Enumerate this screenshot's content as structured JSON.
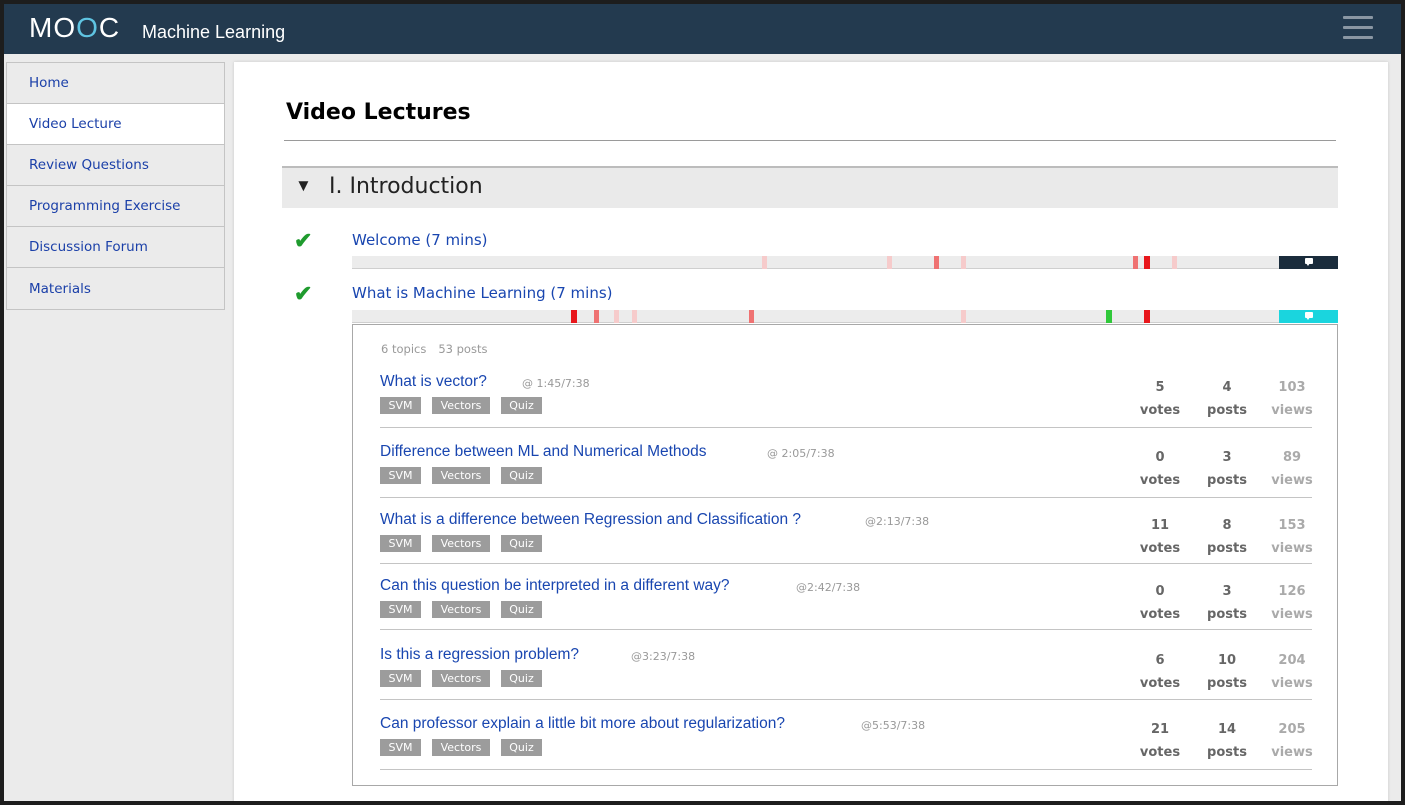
{
  "header": {
    "logo_m": "M",
    "logo_o1": "O",
    "logo_o2": "O",
    "logo_c": "C",
    "course_title": "Machine Learning"
  },
  "sidebar": {
    "items": [
      {
        "label": "Home"
      },
      {
        "label": "Video Lecture"
      },
      {
        "label": "Review Questions"
      },
      {
        "label": "Programming Exercise"
      },
      {
        "label": "Discussion Forum"
      },
      {
        "label": "Materials"
      }
    ],
    "active_index": 1
  },
  "main": {
    "page_title": "Video Lectures",
    "section": {
      "arrow": "▼",
      "title": "I. Introduction"
    },
    "lectures": [
      {
        "check": "✔",
        "title": "Welcome (7 mins)"
      },
      {
        "check": "✔",
        "title": "What is Machine Learning (7 mins)"
      }
    ],
    "forum": {
      "topics_count": "6 topics",
      "posts_count": "53 posts",
      "topics": [
        {
          "title": "What is vector?",
          "time": "@ 1:45/7:38",
          "tags": [
            "SVM",
            "Vectors",
            "Quiz"
          ],
          "votes": "5",
          "votes_label": "votes",
          "posts": "4",
          "posts_label": "posts",
          "views": "103",
          "views_label": "views"
        },
        {
          "title": "Difference between ML and Numerical Methods",
          "time": "@ 2:05/7:38",
          "tags": [
            "SVM",
            "Vectors",
            "Quiz"
          ],
          "votes": "0",
          "votes_label": "votes",
          "posts": "3",
          "posts_label": "posts",
          "views": "89",
          "views_label": "views"
        },
        {
          "title": "What is a difference between Regression and Classification ?",
          "time": "@2:13/7:38",
          "tags": [
            "SVM",
            "Vectors",
            "Quiz"
          ],
          "votes": "11",
          "votes_label": "votes",
          "posts": "8",
          "posts_label": "posts",
          "views": "153",
          "views_label": "views"
        },
        {
          "title": "Can this question be interpreted in a different way?",
          "time": "@2:42/7:38",
          "tags": [
            "SVM",
            "Vectors",
            "Quiz"
          ],
          "votes": "0",
          "votes_label": "votes",
          "posts": "3",
          "posts_label": "posts",
          "views": "126",
          "views_label": "views"
        },
        {
          "title": "Is this a regression problem?",
          "time": "@3:23/7:38",
          "tags": [
            "SVM",
            "Vectors",
            "Quiz"
          ],
          "votes": "6",
          "votes_label": "votes",
          "posts": "10",
          "posts_label": "posts",
          "views": "204",
          "views_label": "views"
        },
        {
          "title": "Can professor explain a little bit more about regularization?",
          "time": "@5:53/7:38",
          "tags": [
            "SVM",
            "Vectors",
            "Quiz"
          ],
          "votes": "21",
          "votes_label": "votes",
          "posts": "14",
          "posts_label": "posts",
          "views": "205",
          "views_label": "views"
        }
      ]
    }
  },
  "colors": {
    "header_bg": "#233a4f",
    "link_blue": "#1946b0",
    "check_green": "#1f9b2e",
    "comment_dark": "#1a2c3c",
    "comment_cyan": "#1ad5de",
    "tag_gray": "#9c9c9c"
  },
  "icons": {
    "menu": "hamburger-menu-icon",
    "collapse": "triangle-down-icon",
    "check": "checkmark-icon",
    "comment": "comment-bubble-icon"
  }
}
